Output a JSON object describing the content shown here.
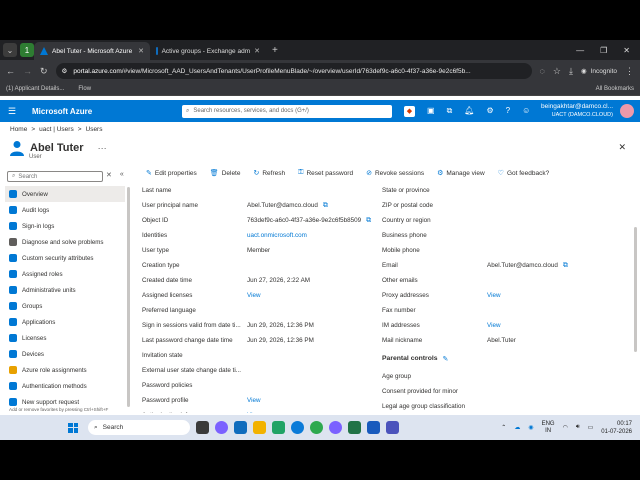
{
  "browser": {
    "tabs": [
      {
        "label": "Abel Tuter - Microsoft Azure",
        "active": true
      },
      {
        "label": "Active groups - Exchange adm",
        "active": false
      }
    ],
    "badge": "1",
    "url_host": "portal.azure.com",
    "url_path": "/#view/Microsoft_AAD_UsersAndTenants/UserProfileMenuBlade/~/overview/userId/763def9c-a6c0-4f37-a36e-9e2c6f5b...",
    "incognito": "Incognito",
    "bookmarks": [
      "(1) Applicant Details...",
      "Flow"
    ],
    "all_bookmarks": "All Bookmarks"
  },
  "azure": {
    "brand": "Microsoft Azure",
    "search_placeholder": "Search resources, services, and docs (G+/)",
    "account_email": "beingakhtar@damco.cl...",
    "account_tenant": "UACT (DAMCO.CLOUD)"
  },
  "breadcrumb": [
    "Home",
    ">",
    "uact | Users",
    ">",
    "Users"
  ],
  "page": {
    "title": "Abel Tuter",
    "subtitle": "User",
    "more": "···"
  },
  "sidebar": {
    "search_placeholder": "Search",
    "items": [
      {
        "label": "Overview",
        "color": "#0078d4",
        "active": true
      },
      {
        "label": "Audit logs",
        "color": "#0078d4"
      },
      {
        "label": "Sign-in logs",
        "color": "#0078d4"
      },
      {
        "label": "Diagnose and solve problems",
        "color": "#605e5c"
      },
      {
        "label": "Custom security attributes",
        "color": "#0078d4"
      },
      {
        "label": "Assigned roles",
        "color": "#0078d4"
      },
      {
        "label": "Administrative units",
        "color": "#0078d4"
      },
      {
        "label": "Groups",
        "color": "#0078d4"
      },
      {
        "label": "Applications",
        "color": "#0078d4"
      },
      {
        "label": "Licenses",
        "color": "#0078d4"
      },
      {
        "label": "Devices",
        "color": "#0078d4"
      },
      {
        "label": "Azure role assignments",
        "color": "#e8a100"
      },
      {
        "label": "Authentication methods",
        "color": "#0078d4"
      },
      {
        "label": "New support request",
        "color": "#0078d4"
      }
    ],
    "hint": "Add or remove favorites by pressing Ctrl+Shift+F"
  },
  "toolbar": [
    "Edit properties",
    "Delete",
    "Refresh",
    "Reset password",
    "Revoke sessions",
    "Manage view",
    "Got feedback?"
  ],
  "left_props": [
    {
      "label": "Last name",
      "value": ""
    },
    {
      "label": "User principal name",
      "value": "Abel.Tuter@damco.cloud",
      "copy": true
    },
    {
      "label": "Object ID",
      "value": "763def9c-a6c0-4f37-a36e-9e2c6f5b8509",
      "copy": true
    },
    {
      "label": "Identities",
      "value": "uact.onmicrosoft.com",
      "link": true
    },
    {
      "label": "User type",
      "value": "Member"
    },
    {
      "label": "Creation type",
      "value": ""
    },
    {
      "label": "Created date time",
      "value": "Jun 27, 2026, 2:22 AM"
    },
    {
      "label": "Assigned licenses",
      "value": "View",
      "link": true
    },
    {
      "label": "Preferred language",
      "value": ""
    },
    {
      "label": "Sign in sessions valid from date ti...",
      "value": "Jun 29, 2026, 12:36 PM"
    },
    {
      "label": "Last password change date time",
      "value": "Jun 29, 2026, 12:36 PM"
    },
    {
      "label": "Invitation state",
      "value": ""
    },
    {
      "label": "External user state change date ti...",
      "value": ""
    },
    {
      "label": "Password policies",
      "value": ""
    },
    {
      "label": "Password profile",
      "value": "View",
      "link": true
    },
    {
      "label": "Authorization info",
      "value": "View",
      "link": true
    }
  ],
  "right_props": [
    {
      "label": "State or province",
      "value": ""
    },
    {
      "label": "ZIP or postal code",
      "value": ""
    },
    {
      "label": "Country or region",
      "value": ""
    },
    {
      "label": "Business phone",
      "value": ""
    },
    {
      "label": "Mobile phone",
      "value": ""
    },
    {
      "label": "Email",
      "value": "Abel.Tuter@damco.cloud",
      "copy": true
    },
    {
      "label": "Other emails",
      "value": ""
    },
    {
      "label": "Proxy addresses",
      "value": "View",
      "link": true
    },
    {
      "label": "Fax number",
      "value": ""
    },
    {
      "label": "IM addresses",
      "value": "View",
      "link": true
    },
    {
      "label": "Mail nickname",
      "value": "Abel.Tuter"
    },
    {
      "label": "Parental controls",
      "section": true
    },
    {
      "label": "Age group",
      "value": ""
    },
    {
      "label": "Consent provided for minor",
      "value": ""
    },
    {
      "label": "Legal age group classification",
      "value": ""
    }
  ],
  "taskbar": {
    "search": "Search",
    "lang1": "ENG",
    "lang2": "IN",
    "time": "00:17",
    "date": "01-07-2026"
  }
}
